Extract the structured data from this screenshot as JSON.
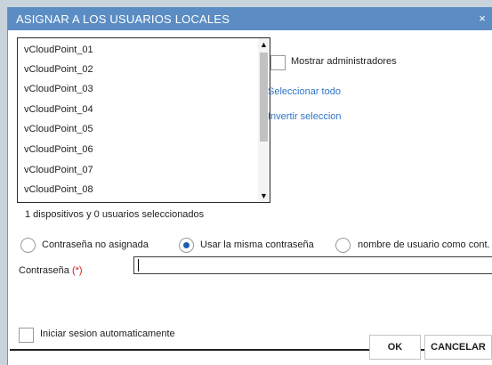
{
  "dialog": {
    "title": "ASIGNAR A LOS USUARIOS LOCALES",
    "close_glyph": "×"
  },
  "user_list": {
    "items": [
      "vCloudPoint_01",
      "vCloudPoint_02",
      "vCloudPoint_03",
      "vCloudPoint_04",
      "vCloudPoint_05",
      "vCloudPoint_06",
      "vCloudPoint_07",
      "vCloudPoint_08"
    ],
    "scroll_up_glyph": "▲",
    "scroll_down_glyph": "▼"
  },
  "options": {
    "show_admins_label": "Mostrar administradores",
    "select_all_link": "Seleccionar todo",
    "invert_selection_link": "Invertir seleccion"
  },
  "status": {
    "selection_text": "1 dispositivos y 0 usuarios seleccionados"
  },
  "password_mode": {
    "options": [
      {
        "label": "Contraseña no asignada",
        "checked": false
      },
      {
        "label": "Usar la misma contraseña",
        "checked": true
      },
      {
        "label": "nombre de usuario como cont.",
        "checked": false
      }
    ]
  },
  "password_field": {
    "label": "Contraseña",
    "required_mark": "(*)",
    "value": ""
  },
  "auto_login": {
    "label": "Iniciar sesion automaticamente",
    "checked": false
  },
  "buttons": {
    "ok_label": "OK",
    "cancel_label": "CANCELAR"
  },
  "colors": {
    "titlebar": "#5b8cc3",
    "link": "#2f75c8",
    "required": "#d11a1a",
    "radio_selected": "#1f5fb0"
  }
}
